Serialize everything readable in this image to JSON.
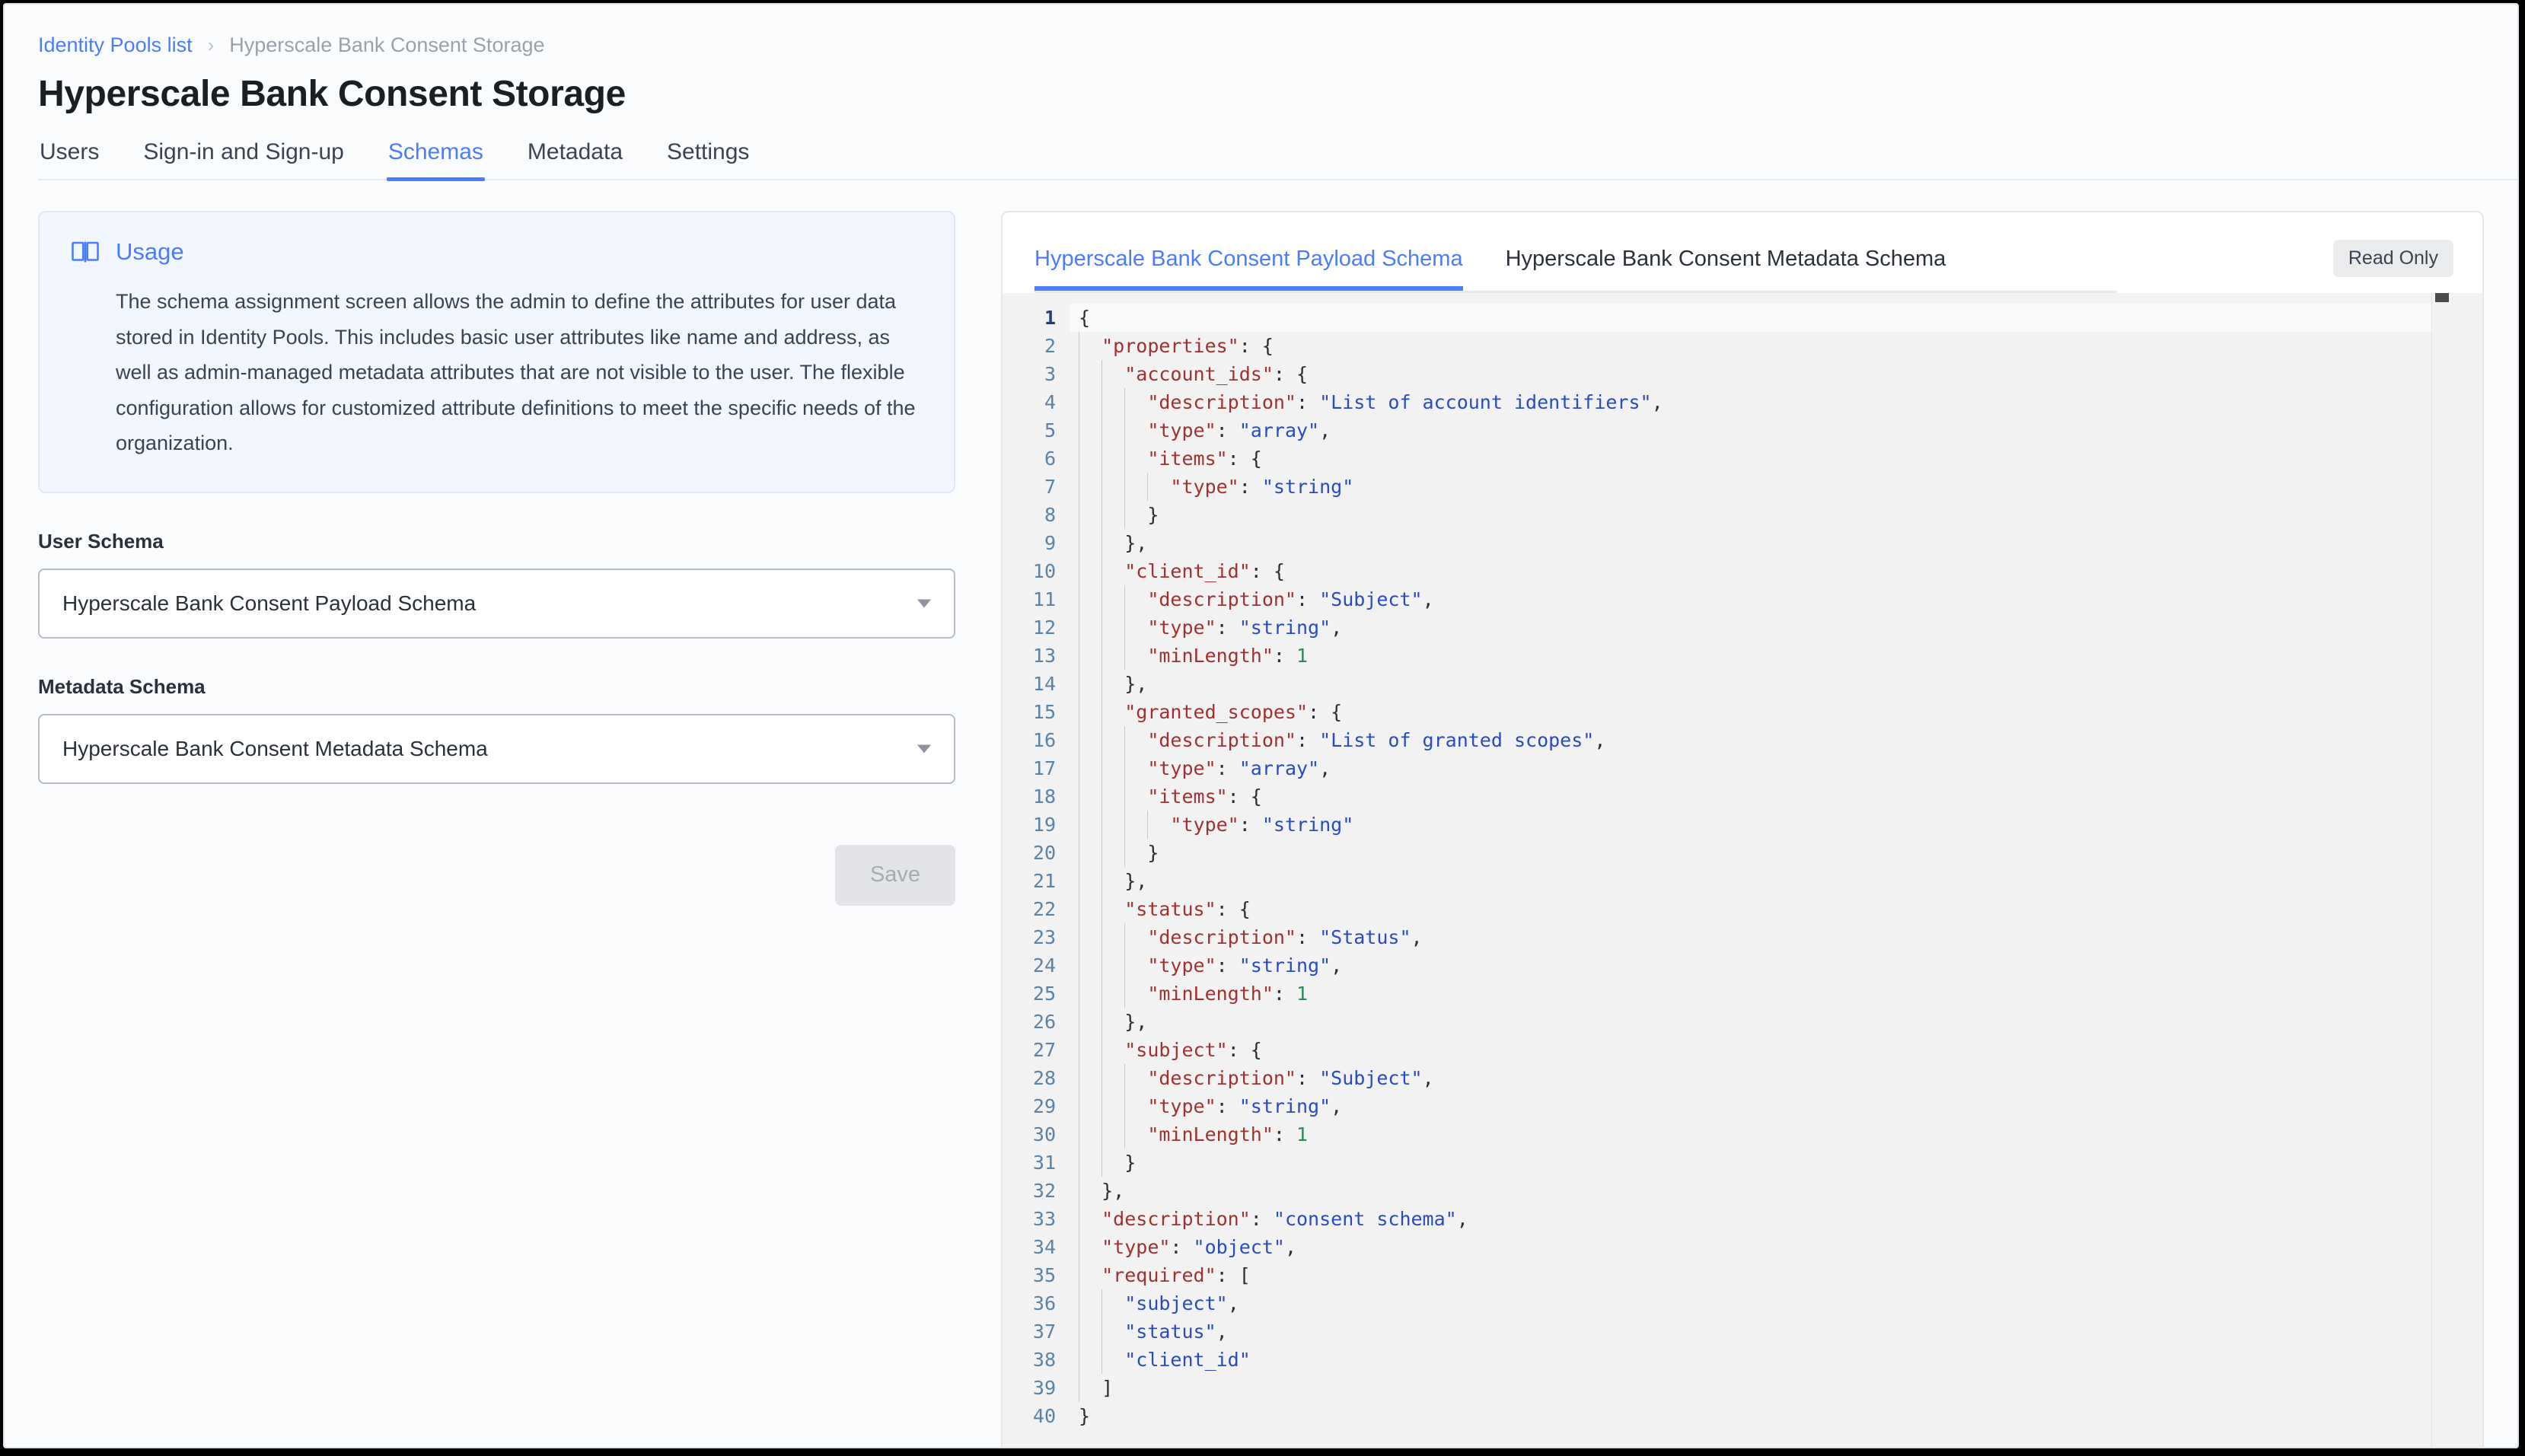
{
  "breadcrumb": {
    "parent": "Identity Pools list",
    "separator": "›",
    "current": "Hyperscale Bank Consent Storage"
  },
  "page_title": "Hyperscale Bank Consent Storage",
  "tabs": [
    {
      "label": "Users",
      "active": false
    },
    {
      "label": "Sign-in and Sign-up",
      "active": false
    },
    {
      "label": "Schemas",
      "active": true
    },
    {
      "label": "Metadata",
      "active": false
    },
    {
      "label": "Settings",
      "active": false
    }
  ],
  "usage": {
    "icon": "book-icon",
    "title": "Usage",
    "text": "The schema assignment screen allows the admin to define the attributes for user data stored in Identity Pools. This includes basic user attributes like name and address, as well as admin-managed metadata attributes that are not visible to the user. The flexible configuration allows for customized attribute definitions to meet the specific needs of the organization."
  },
  "form": {
    "user_schema": {
      "label": "User Schema",
      "value": "Hyperscale Bank Consent Payload Schema"
    },
    "metadata_schema": {
      "label": "Metadata Schema",
      "value": "Hyperscale Bank Consent Metadata Schema"
    },
    "save_label": "Save"
  },
  "editor": {
    "tabs": [
      {
        "label": "Hyperscale Bank Consent Payload Schema",
        "active": true
      },
      {
        "label": "Hyperscale Bank Consent Metadata Schema",
        "active": false
      }
    ],
    "readonly_badge": "Read Only",
    "active_line": 1,
    "total_lines": 40,
    "lines": [
      {
        "n": 1,
        "indent": 0,
        "tokens": [
          {
            "t": "p",
            "v": "{"
          }
        ]
      },
      {
        "n": 2,
        "indent": 1,
        "tokens": [
          {
            "t": "k",
            "v": "\"properties\""
          },
          {
            "t": "p",
            "v": ": {"
          }
        ]
      },
      {
        "n": 3,
        "indent": 2,
        "tokens": [
          {
            "t": "k",
            "v": "\"account_ids\""
          },
          {
            "t": "p",
            "v": ": {"
          }
        ]
      },
      {
        "n": 4,
        "indent": 3,
        "tokens": [
          {
            "t": "k",
            "v": "\"description\""
          },
          {
            "t": "p",
            "v": ": "
          },
          {
            "t": "s",
            "v": "\"List of account identifiers\""
          },
          {
            "t": "p",
            "v": ","
          }
        ]
      },
      {
        "n": 5,
        "indent": 3,
        "tokens": [
          {
            "t": "k",
            "v": "\"type\""
          },
          {
            "t": "p",
            "v": ": "
          },
          {
            "t": "s",
            "v": "\"array\""
          },
          {
            "t": "p",
            "v": ","
          }
        ]
      },
      {
        "n": 6,
        "indent": 3,
        "tokens": [
          {
            "t": "k",
            "v": "\"items\""
          },
          {
            "t": "p",
            "v": ": {"
          }
        ]
      },
      {
        "n": 7,
        "indent": 4,
        "tokens": [
          {
            "t": "k",
            "v": "\"type\""
          },
          {
            "t": "p",
            "v": ": "
          },
          {
            "t": "s",
            "v": "\"string\""
          }
        ]
      },
      {
        "n": 8,
        "indent": 3,
        "tokens": [
          {
            "t": "p",
            "v": "}"
          }
        ]
      },
      {
        "n": 9,
        "indent": 2,
        "tokens": [
          {
            "t": "p",
            "v": "},"
          }
        ]
      },
      {
        "n": 10,
        "indent": 2,
        "tokens": [
          {
            "t": "k",
            "v": "\"client_id\""
          },
          {
            "t": "p",
            "v": ": {"
          }
        ]
      },
      {
        "n": 11,
        "indent": 3,
        "tokens": [
          {
            "t": "k",
            "v": "\"description\""
          },
          {
            "t": "p",
            "v": ": "
          },
          {
            "t": "s",
            "v": "\"Subject\""
          },
          {
            "t": "p",
            "v": ","
          }
        ]
      },
      {
        "n": 12,
        "indent": 3,
        "tokens": [
          {
            "t": "k",
            "v": "\"type\""
          },
          {
            "t": "p",
            "v": ": "
          },
          {
            "t": "s",
            "v": "\"string\""
          },
          {
            "t": "p",
            "v": ","
          }
        ]
      },
      {
        "n": 13,
        "indent": 3,
        "tokens": [
          {
            "t": "k",
            "v": "\"minLength\""
          },
          {
            "t": "p",
            "v": ": "
          },
          {
            "t": "n",
            "v": "1"
          }
        ]
      },
      {
        "n": 14,
        "indent": 2,
        "tokens": [
          {
            "t": "p",
            "v": "},"
          }
        ]
      },
      {
        "n": 15,
        "indent": 2,
        "tokens": [
          {
            "t": "k",
            "v": "\"granted_scopes\""
          },
          {
            "t": "p",
            "v": ": {"
          }
        ]
      },
      {
        "n": 16,
        "indent": 3,
        "tokens": [
          {
            "t": "k",
            "v": "\"description\""
          },
          {
            "t": "p",
            "v": ": "
          },
          {
            "t": "s",
            "v": "\"List of granted scopes\""
          },
          {
            "t": "p",
            "v": ","
          }
        ]
      },
      {
        "n": 17,
        "indent": 3,
        "tokens": [
          {
            "t": "k",
            "v": "\"type\""
          },
          {
            "t": "p",
            "v": ": "
          },
          {
            "t": "s",
            "v": "\"array\""
          },
          {
            "t": "p",
            "v": ","
          }
        ]
      },
      {
        "n": 18,
        "indent": 3,
        "tokens": [
          {
            "t": "k",
            "v": "\"items\""
          },
          {
            "t": "p",
            "v": ": {"
          }
        ]
      },
      {
        "n": 19,
        "indent": 4,
        "tokens": [
          {
            "t": "k",
            "v": "\"type\""
          },
          {
            "t": "p",
            "v": ": "
          },
          {
            "t": "s",
            "v": "\"string\""
          }
        ]
      },
      {
        "n": 20,
        "indent": 3,
        "tokens": [
          {
            "t": "p",
            "v": "}"
          }
        ]
      },
      {
        "n": 21,
        "indent": 2,
        "tokens": [
          {
            "t": "p",
            "v": "},"
          }
        ]
      },
      {
        "n": 22,
        "indent": 2,
        "tokens": [
          {
            "t": "k",
            "v": "\"status\""
          },
          {
            "t": "p",
            "v": ": {"
          }
        ]
      },
      {
        "n": 23,
        "indent": 3,
        "tokens": [
          {
            "t": "k",
            "v": "\"description\""
          },
          {
            "t": "p",
            "v": ": "
          },
          {
            "t": "s",
            "v": "\"Status\""
          },
          {
            "t": "p",
            "v": ","
          }
        ]
      },
      {
        "n": 24,
        "indent": 3,
        "tokens": [
          {
            "t": "k",
            "v": "\"type\""
          },
          {
            "t": "p",
            "v": ": "
          },
          {
            "t": "s",
            "v": "\"string\""
          },
          {
            "t": "p",
            "v": ","
          }
        ]
      },
      {
        "n": 25,
        "indent": 3,
        "tokens": [
          {
            "t": "k",
            "v": "\"minLength\""
          },
          {
            "t": "p",
            "v": ": "
          },
          {
            "t": "n",
            "v": "1"
          }
        ]
      },
      {
        "n": 26,
        "indent": 2,
        "tokens": [
          {
            "t": "p",
            "v": "},"
          }
        ]
      },
      {
        "n": 27,
        "indent": 2,
        "tokens": [
          {
            "t": "k",
            "v": "\"subject\""
          },
          {
            "t": "p",
            "v": ": {"
          }
        ]
      },
      {
        "n": 28,
        "indent": 3,
        "tokens": [
          {
            "t": "k",
            "v": "\"description\""
          },
          {
            "t": "p",
            "v": ": "
          },
          {
            "t": "s",
            "v": "\"Subject\""
          },
          {
            "t": "p",
            "v": ","
          }
        ]
      },
      {
        "n": 29,
        "indent": 3,
        "tokens": [
          {
            "t": "k",
            "v": "\"type\""
          },
          {
            "t": "p",
            "v": ": "
          },
          {
            "t": "s",
            "v": "\"string\""
          },
          {
            "t": "p",
            "v": ","
          }
        ]
      },
      {
        "n": 30,
        "indent": 3,
        "tokens": [
          {
            "t": "k",
            "v": "\"minLength\""
          },
          {
            "t": "p",
            "v": ": "
          },
          {
            "t": "n",
            "v": "1"
          }
        ]
      },
      {
        "n": 31,
        "indent": 2,
        "tokens": [
          {
            "t": "p",
            "v": "}"
          }
        ]
      },
      {
        "n": 32,
        "indent": 1,
        "tokens": [
          {
            "t": "p",
            "v": "},"
          }
        ]
      },
      {
        "n": 33,
        "indent": 1,
        "tokens": [
          {
            "t": "k",
            "v": "\"description\""
          },
          {
            "t": "p",
            "v": ": "
          },
          {
            "t": "s",
            "v": "\"consent schema\""
          },
          {
            "t": "p",
            "v": ","
          }
        ]
      },
      {
        "n": 34,
        "indent": 1,
        "tokens": [
          {
            "t": "k",
            "v": "\"type\""
          },
          {
            "t": "p",
            "v": ": "
          },
          {
            "t": "s",
            "v": "\"object\""
          },
          {
            "t": "p",
            "v": ","
          }
        ]
      },
      {
        "n": 35,
        "indent": 1,
        "tokens": [
          {
            "t": "k",
            "v": "\"required\""
          },
          {
            "t": "p",
            "v": ": ["
          }
        ]
      },
      {
        "n": 36,
        "indent": 2,
        "tokens": [
          {
            "t": "s",
            "v": "\"subject\""
          },
          {
            "t": "p",
            "v": ","
          }
        ]
      },
      {
        "n": 37,
        "indent": 2,
        "tokens": [
          {
            "t": "s",
            "v": "\"status\""
          },
          {
            "t": "p",
            "v": ","
          }
        ]
      },
      {
        "n": 38,
        "indent": 2,
        "tokens": [
          {
            "t": "s",
            "v": "\"client_id\""
          }
        ]
      },
      {
        "n": 39,
        "indent": 1,
        "tokens": [
          {
            "t": "p",
            "v": "]"
          }
        ]
      },
      {
        "n": 40,
        "indent": 0,
        "tokens": [
          {
            "t": "p",
            "v": "}"
          }
        ]
      }
    ]
  },
  "colors": {
    "accent": "#4a7dfc",
    "usage_bg": "#f2f6fe",
    "editor_bg": "#f2f2f2",
    "key": "#a03131",
    "string": "#2a4bbf",
    "number": "#2e8b57"
  }
}
